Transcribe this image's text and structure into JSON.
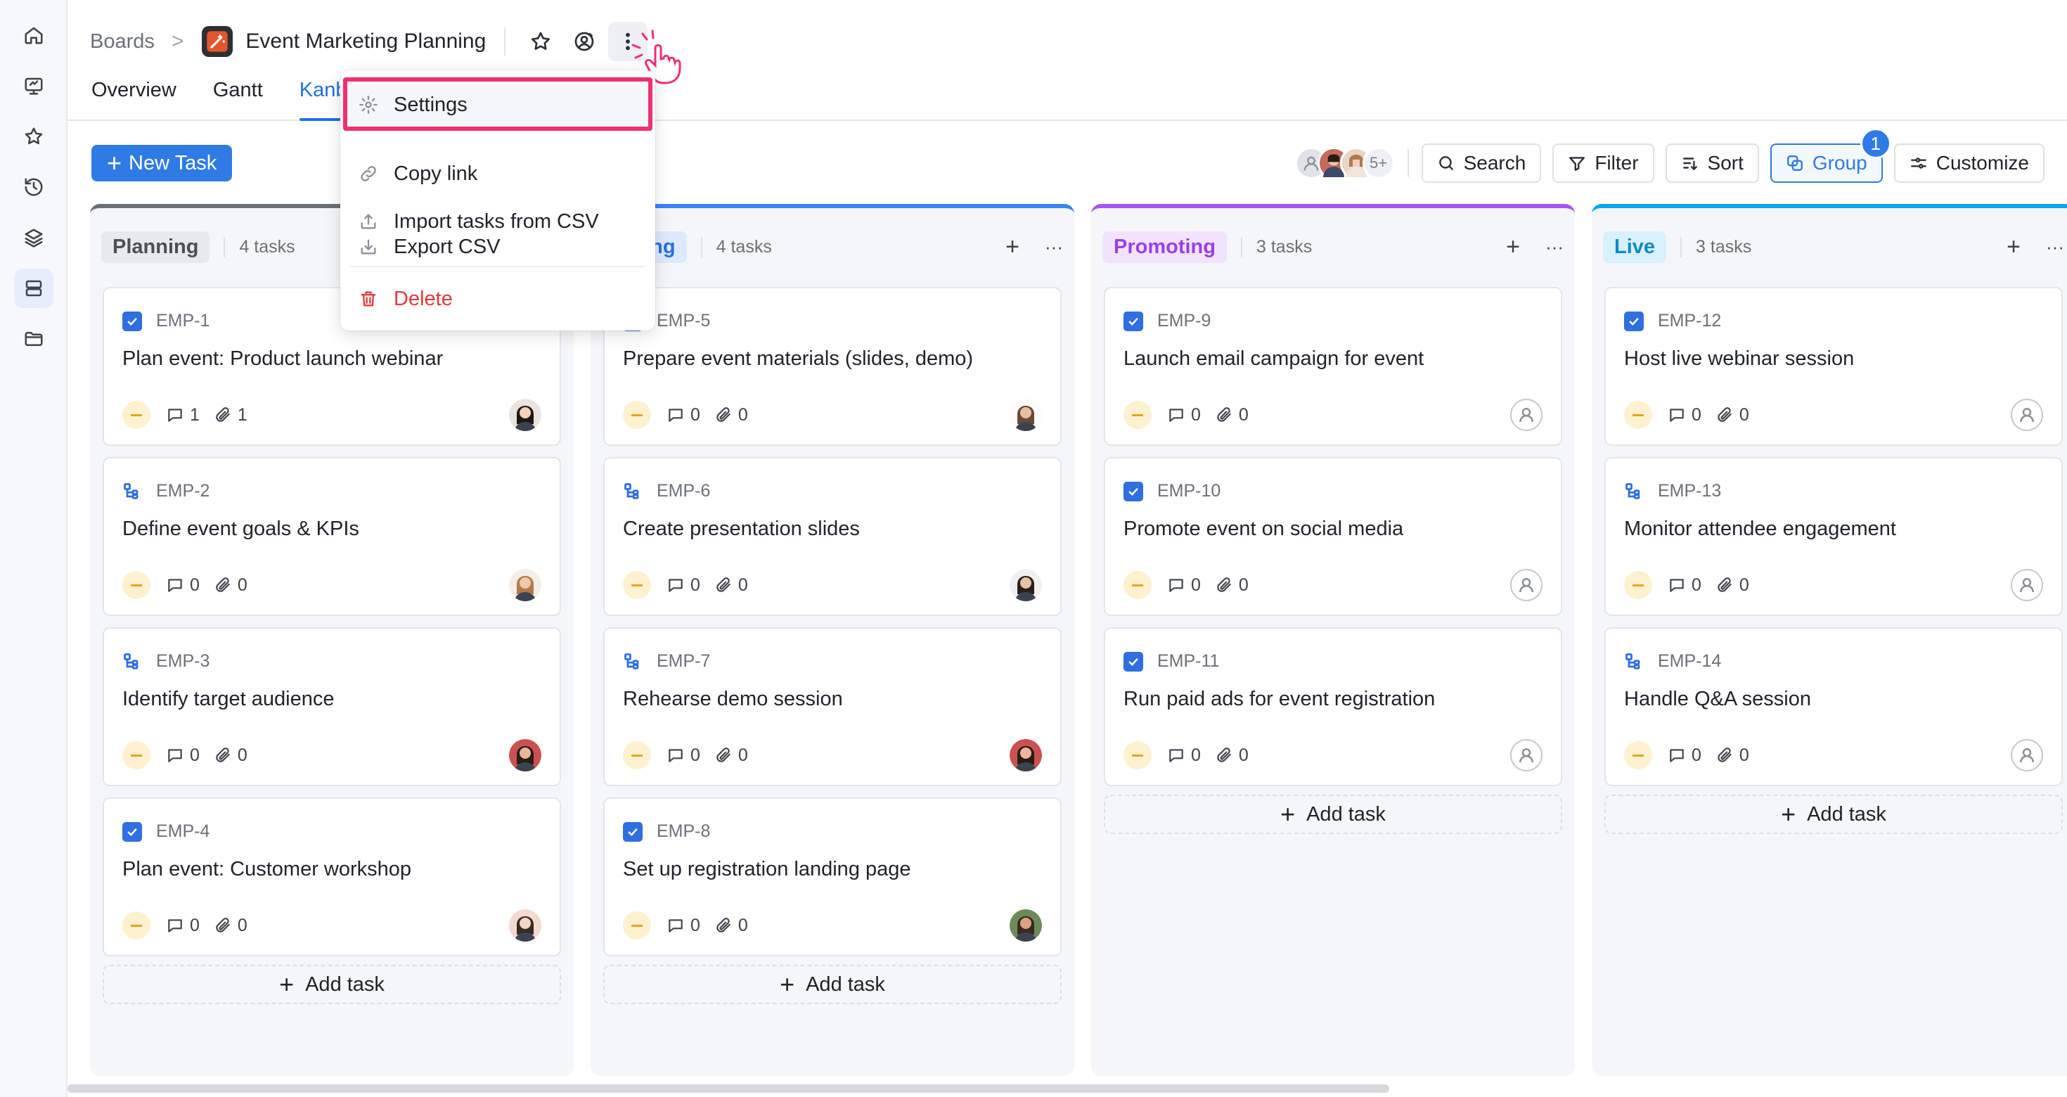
{
  "breadcrumb": {
    "root": "Boards",
    "separator": ">",
    "project": "Event Marketing Planning"
  },
  "tabs": [
    {
      "label": "Overview",
      "active": false
    },
    {
      "label": "Gantt",
      "active": false
    },
    {
      "label": "Kanb",
      "active": true
    }
  ],
  "toolbar": {
    "new_task_label": "New Task",
    "avatars_more": "5+",
    "search_label": "Search",
    "filter_label": "Filter",
    "sort_label": "Sort",
    "group_label": "Group",
    "group_badge": "1",
    "customize_label": "Customize"
  },
  "menu": {
    "settings": "Settings",
    "copy_link": "Copy link",
    "import_csv": "Import tasks from CSV",
    "export_csv": "Export CSV",
    "delete": "Delete"
  },
  "add_task_label": "Add task",
  "columns": [
    {
      "name": "Planning",
      "count": "4 tasks",
      "accent": "#6b6f76",
      "pill_bg": "#e8e9ec",
      "pill_fg": "#4a4f57",
      "cards": [
        {
          "id": "EMP-1",
          "title": "Plan event: Product launch webinar",
          "type": "task",
          "comments": "1",
          "attachments": "1",
          "assignee": "photo"
        },
        {
          "id": "EMP-2",
          "title": "Define event goals & KPIs",
          "type": "subtask",
          "comments": "0",
          "attachments": "0",
          "assignee": "photo"
        },
        {
          "id": "EMP-3",
          "title": "Identify target audience",
          "type": "subtask",
          "comments": "0",
          "attachments": "0",
          "assignee": "photo"
        },
        {
          "id": "EMP-4",
          "title": "Plan event: Customer workshop",
          "type": "task",
          "comments": "0",
          "attachments": "0",
          "assignee": "photo"
        }
      ]
    },
    {
      "name": "paring",
      "count": "4 tasks",
      "accent": "#3b82f6",
      "pill_bg": "#dde9fd",
      "pill_fg": "#2a6fe0",
      "cards": [
        {
          "id": "EMP-5",
          "title": "Prepare event materials (slides, demo)",
          "type": "task",
          "comments": "0",
          "attachments": "0",
          "assignee": "photo"
        },
        {
          "id": "EMP-6",
          "title": "Create presentation slides",
          "type": "subtask",
          "comments": "0",
          "attachments": "0",
          "assignee": "photo"
        },
        {
          "id": "EMP-7",
          "title": "Rehearse demo session",
          "type": "subtask",
          "comments": "0",
          "attachments": "0",
          "assignee": "photo"
        },
        {
          "id": "EMP-8",
          "title": "Set up registration landing page",
          "type": "task",
          "comments": "0",
          "attachments": "0",
          "assignee": "photo"
        }
      ]
    },
    {
      "name": "Promoting",
      "count": "3 tasks",
      "accent": "#a855f7",
      "pill_bg": "#f1e3fd",
      "pill_fg": "#9b3fe6",
      "cards": [
        {
          "id": "EMP-9",
          "title": "Launch email campaign for event",
          "type": "task",
          "comments": "0",
          "attachments": "0",
          "assignee": "empty"
        },
        {
          "id": "EMP-10",
          "title": "Promote event on social media",
          "type": "task",
          "comments": "0",
          "attachments": "0",
          "assignee": "empty"
        },
        {
          "id": "EMP-11",
          "title": "Run paid ads for event registration",
          "type": "task",
          "comments": "0",
          "attachments": "0",
          "assignee": "empty"
        }
      ]
    },
    {
      "name": "Live",
      "count": "3 tasks",
      "accent": "#0ea5e9",
      "pill_bg": "#d9f1fc",
      "pill_fg": "#0b8cc7",
      "cards": [
        {
          "id": "EMP-12",
          "title": "Host live webinar session",
          "type": "task",
          "comments": "0",
          "attachments": "0",
          "assignee": "empty"
        },
        {
          "id": "EMP-13",
          "title": "Monitor attendee engagement",
          "type": "subtask",
          "comments": "0",
          "attachments": "0",
          "assignee": "empty"
        },
        {
          "id": "EMP-14",
          "title": "Handle Q&A session",
          "type": "subtask",
          "comments": "0",
          "attachments": "0",
          "assignee": "empty"
        }
      ]
    }
  ]
}
